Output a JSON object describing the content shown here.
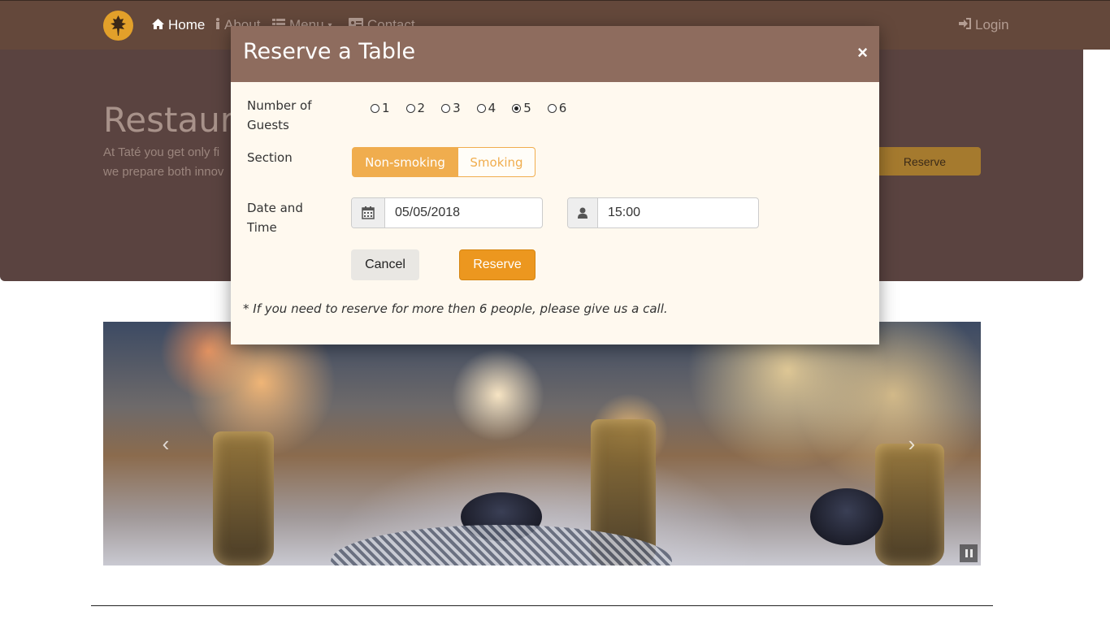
{
  "navbar": {
    "items": [
      {
        "label": "Home",
        "icon": "home-icon"
      },
      {
        "label": "About",
        "icon": "info-icon"
      },
      {
        "label": "Menu",
        "icon": "list-icon"
      },
      {
        "label": "Contact",
        "icon": "address-card-icon"
      }
    ],
    "login_label": "Login",
    "login_icon": "sign-in-icon"
  },
  "jumbotron": {
    "title": "Restaurar",
    "text_line1": "At Taté you get only fi",
    "text_line2": "we prepare both innov",
    "reserve_label": "Reserve"
  },
  "modal": {
    "title": "Reserve a Table",
    "close_label": "×",
    "guests": {
      "label_line1": "Number of",
      "label_line2": "Guests",
      "options": [
        "1",
        "2",
        "3",
        "4",
        "5",
        "6"
      ],
      "selected": "5"
    },
    "section": {
      "label": "Section",
      "options": [
        "Non-smoking",
        "Smoking"
      ],
      "selected": "Non-smoking"
    },
    "datetime": {
      "label_line1": "Date and",
      "label_line2": "Time",
      "date_value": "05/05/2018",
      "date_icon": "calendar-icon",
      "time_value": "15:00",
      "time_icon": "user-icon"
    },
    "cancel_label": "Cancel",
    "reserve_label": "Reserve",
    "note": "* If you need to reserve for more then 6 people, please give us a call."
  },
  "colors": {
    "navbar": "#64483b",
    "modal_header": "#8e6c5e",
    "modal_body": "#fff9ef",
    "warning": "#f0ad4e",
    "logo": "#e2a02a"
  }
}
